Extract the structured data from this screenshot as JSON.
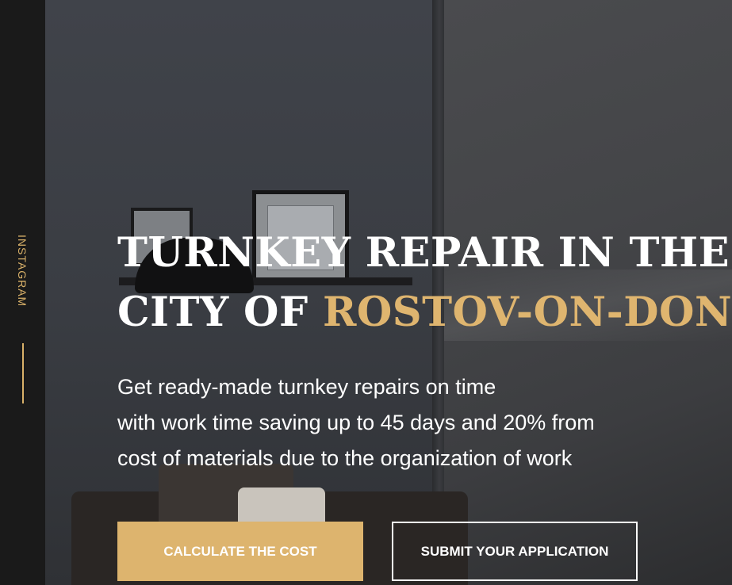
{
  "sidebar": {
    "social_label": "INSTAGRAM"
  },
  "hero": {
    "headline_line1": "TURNKEY REPAIR IN THE",
    "headline_line2_prefix": "CITY OF ",
    "headline_city": "ROSTOV-ON-DON",
    "subtitle_line1": "Get ready-made turnkey repairs on time",
    "subtitle_line2": "with work time saving up to 45 days and 20% from",
    "subtitle_line3": "cost of materials due to the organization of work",
    "primary_button": "CALCULATE THE COST",
    "secondary_button": "SUBMIT YOUR APPLICATION"
  },
  "colors": {
    "accent": "#ddb46e",
    "sidebar_bg": "#1a1a1a",
    "text": "#ffffff"
  }
}
